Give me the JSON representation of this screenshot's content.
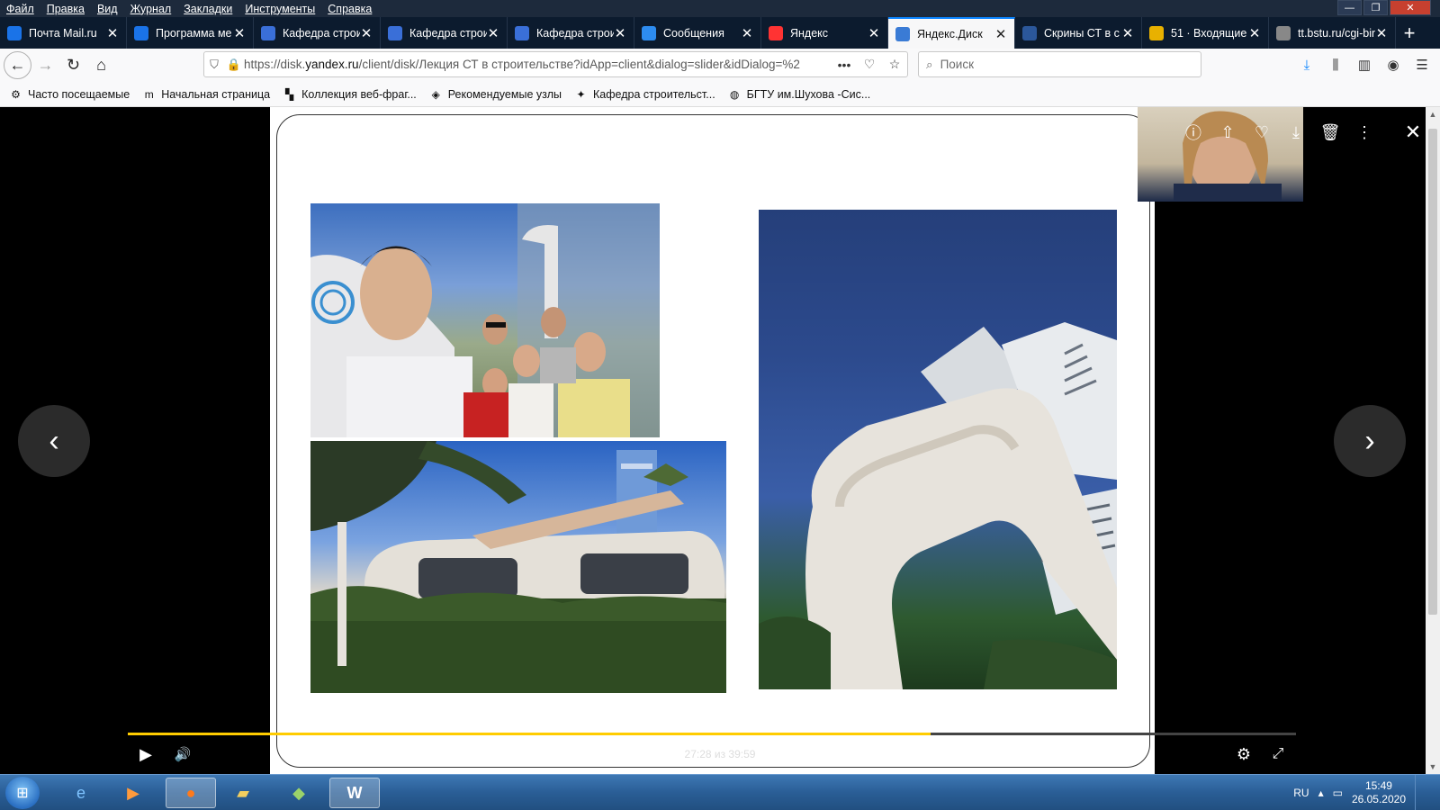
{
  "menu": [
    "Файл",
    "Правка",
    "Вид",
    "Журнал",
    "Закладки",
    "Инструменты",
    "Справка"
  ],
  "tabs": [
    {
      "label": "Почта Mail.ru",
      "icon": "mail-icon",
      "color": "#1a73e8"
    },
    {
      "label": "Программа ме",
      "icon": "mail-icon",
      "color": "#1a73e8"
    },
    {
      "label": "Кафедра строи",
      "icon": "dept-icon",
      "color": "#3a6fd8"
    },
    {
      "label": "Кафедра строи",
      "icon": "dept-icon",
      "color": "#3a6fd8"
    },
    {
      "label": "Кафедра строи",
      "icon": "dept-icon",
      "color": "#3a6fd8"
    },
    {
      "label": "Сообщения",
      "icon": "chat-icon",
      "color": "#2d8cf0"
    },
    {
      "label": "Яндекс",
      "icon": "yandex-icon",
      "color": "#ff3333"
    },
    {
      "label": "Яндекс.Диск",
      "icon": "disk-icon",
      "color": "#3a7bd5",
      "active": true
    },
    {
      "label": "Скрины СТ в с",
      "icon": "word-icon",
      "color": "#2b579a"
    },
    {
      "label": "51 · Входящие",
      "icon": "mail-icon",
      "color": "#e8b100"
    },
    {
      "label": "tt.bstu.ru/cgi-bin/ti",
      "icon": "page-icon",
      "color": "#888888"
    }
  ],
  "newtab_label": "+",
  "url": {
    "prefix": "https://disk.",
    "domain": "yandex.ru",
    "rest": "/client/disk/Лекция СТ в строительстве?idApp=client&dialog=slider&idDialog=%2"
  },
  "search_placeholder": "Поиск",
  "bookmarks": [
    {
      "label": "Часто посещаемые",
      "icon": "gear-icon"
    },
    {
      "label": "Начальная страница",
      "icon": "m-icon"
    },
    {
      "label": "Коллекция веб-фраг...",
      "icon": "slice-icon"
    },
    {
      "label": "Рекомендуемые узлы",
      "icon": "recommend-icon"
    },
    {
      "label": "Кафедра строительст...",
      "icon": "dept-icon"
    },
    {
      "label": "БГТУ им.Шухова -Сис...",
      "icon": "globe-icon"
    }
  ],
  "video": {
    "time": "27:28 из 39:59",
    "progress": 0.687
  },
  "taskbar": {
    "lang": "RU",
    "time": "15:49",
    "date": "26.05.2020"
  },
  "colors": {
    "accent": "#ffcc00",
    "tab_active_border": "#0a84ff"
  }
}
